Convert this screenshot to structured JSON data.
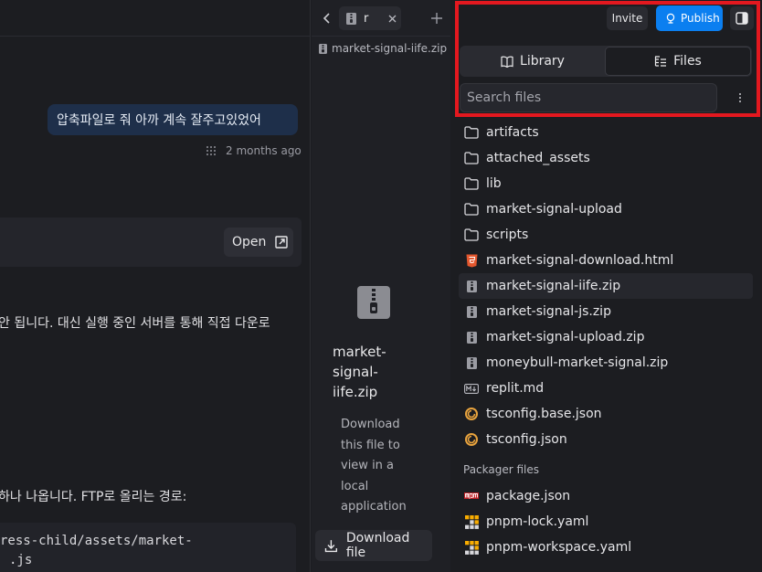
{
  "chat": {
    "user_message": "압축파일로 줘 아까 계속 잘주고있었어",
    "message_time": "2 months ago",
    "open_label": "Open",
    "line1": "안 됩니다. 대신 실행 중인 서버를 통해 직접 다운로",
    "line2": "하나 나옵니다. FTP로 올리는 경로:",
    "code_line1": "ress-child/assets/market-",
    "code_line2": ".js"
  },
  "preview": {
    "tab_label": "r",
    "path": "market-signal-iife.zip",
    "file_name_lines": [
      "market-",
      "signal-",
      "iife.zip"
    ],
    "note_lines": [
      "Download",
      "this file to",
      "view in a",
      "local",
      "application"
    ],
    "download_label": "Download file"
  },
  "header": {
    "invite_label": "Invite",
    "publish_label": "Publish"
  },
  "files_panel": {
    "tabs": [
      {
        "label": "Library",
        "icon": "book-icon",
        "active": false
      },
      {
        "label": "Files",
        "icon": "file-tree-icon",
        "active": true
      }
    ],
    "search_placeholder": "Search files",
    "items": [
      {
        "label": "artifacts",
        "icon": "folder-icon"
      },
      {
        "label": "attached_assets",
        "icon": "folder-icon"
      },
      {
        "label": "lib",
        "icon": "folder-icon"
      },
      {
        "label": "market-signal-upload",
        "icon": "folder-icon"
      },
      {
        "label": "scripts",
        "icon": "folder-icon"
      },
      {
        "label": "market-signal-download.html",
        "icon": "html-icon"
      },
      {
        "label": "market-signal-iife.zip",
        "icon": "zip-icon",
        "selected": true
      },
      {
        "label": "market-signal-js.zip",
        "icon": "zip-icon"
      },
      {
        "label": "market-signal-upload.zip",
        "icon": "zip-icon"
      },
      {
        "label": "moneybull-market-signal.zip",
        "icon": "zip-icon"
      },
      {
        "label": "replit.md",
        "icon": "markdown-icon"
      },
      {
        "label": "tsconfig.base.json",
        "icon": "tsconfig-icon"
      },
      {
        "label": "tsconfig.json",
        "icon": "tsconfig-icon"
      }
    ],
    "section_label": "Packager files",
    "packager_items": [
      {
        "label": "package.json",
        "icon": "npm-icon"
      },
      {
        "label": "pnpm-lock.yaml",
        "icon": "pnpm-icon"
      },
      {
        "label": "pnpm-workspace.yaml",
        "icon": "pnpm-icon"
      }
    ]
  },
  "colors": {
    "accent": "#0b7ff0",
    "highlight": "#e3181f",
    "background": "#1c1d21"
  }
}
